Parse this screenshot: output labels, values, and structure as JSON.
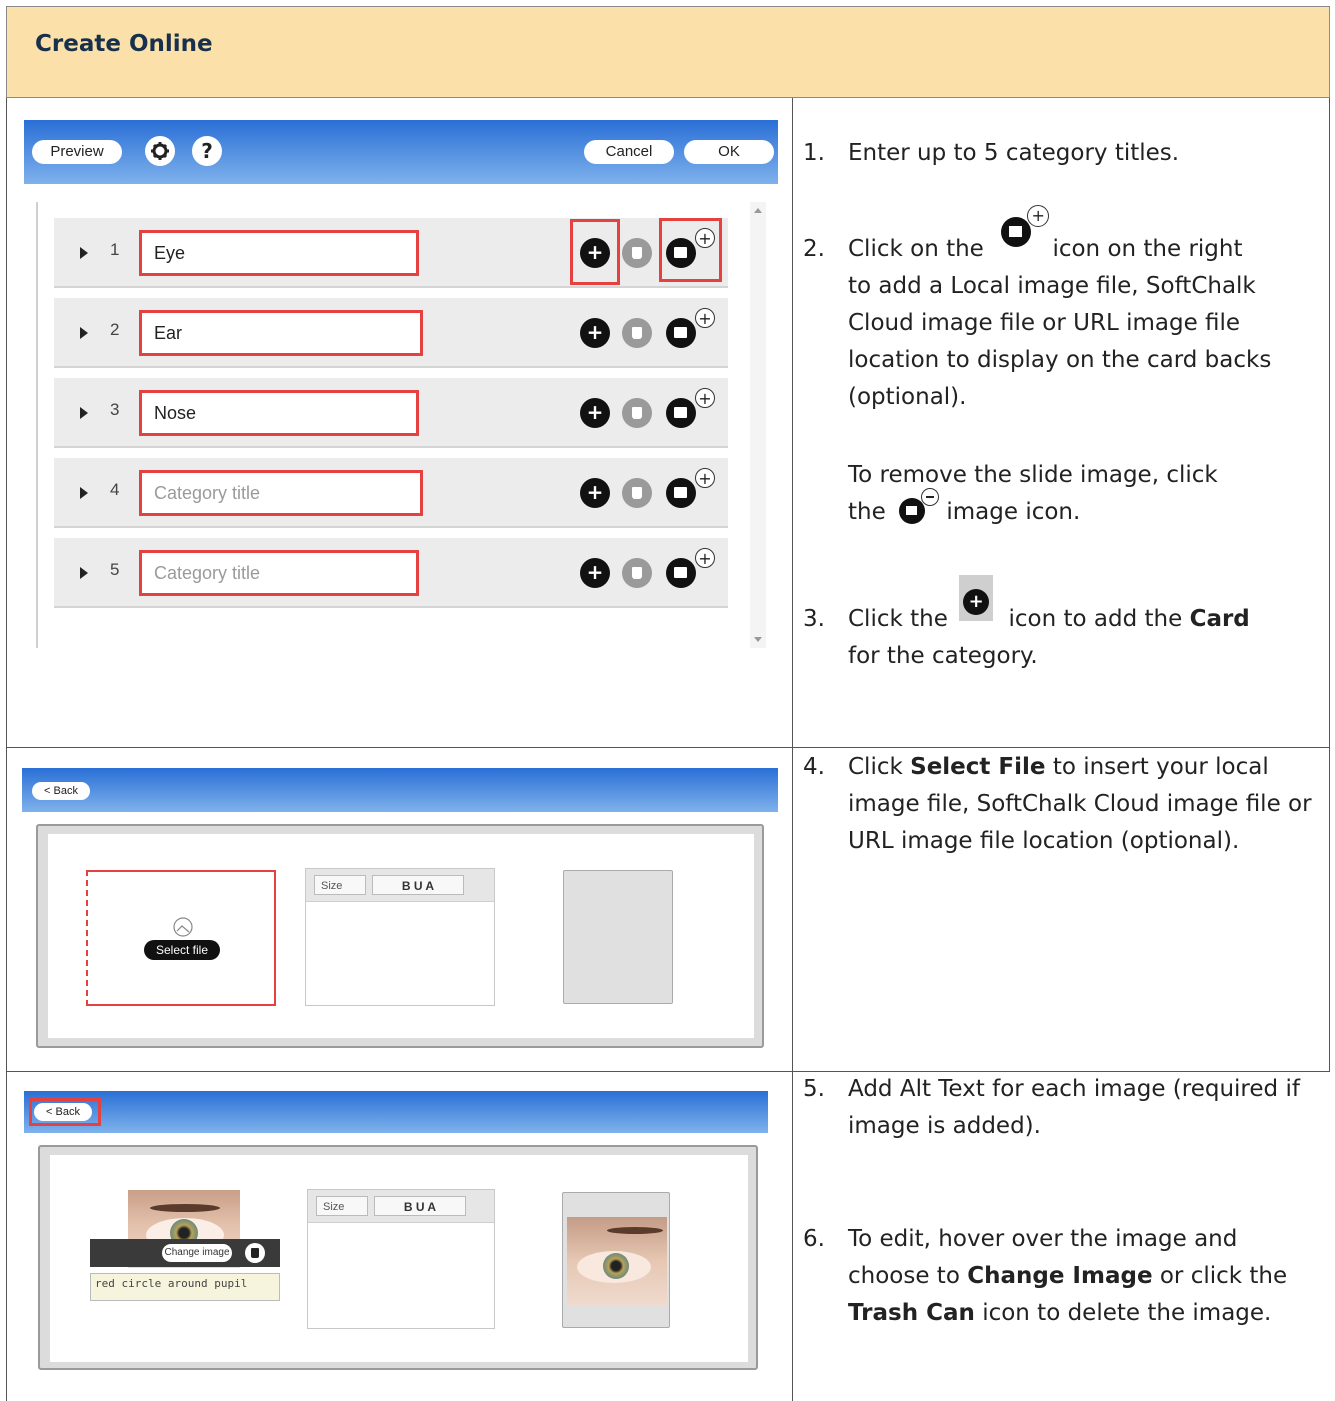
{
  "header": {
    "title": "Create Online"
  },
  "editor": {
    "preview_label": "Preview",
    "settings_icon": "gear-icon",
    "help_label": "?",
    "cancel_label": "Cancel",
    "ok_label": "OK",
    "categories": [
      {
        "num": "1",
        "value": "Eye",
        "placeholder": ""
      },
      {
        "num": "2",
        "value": "Ear",
        "placeholder": ""
      },
      {
        "num": "3",
        "value": "Nose",
        "placeholder": ""
      },
      {
        "num": "4",
        "value": "",
        "placeholder": "Category title"
      },
      {
        "num": "5",
        "value": "",
        "placeholder": "Category title"
      }
    ],
    "plus_glyph": "+"
  },
  "card_editor_a": {
    "back_label": "< Back",
    "select_file_label": "Select file",
    "size_label": "Size",
    "format_label": "B  U  A"
  },
  "card_editor_b": {
    "back_label": "< Back",
    "change_image_label": "Change image",
    "alt_text": "red circle around pupil",
    "size_label": "Size",
    "format_label": "B  U  A"
  },
  "steps": {
    "s1": {
      "n": "1.",
      "text": "Enter up to 5 category titles."
    },
    "s2": {
      "n": "2.",
      "a": "Click on the",
      "b": "icon on the right",
      "c": "to add a Local image file, SoftChalk Cloud image file or URL image file location to display on the card backs (optional)."
    },
    "s2b": {
      "a": "To remove the slide image, click",
      "b": "the",
      "c": "image icon."
    },
    "s3": {
      "n": "3.",
      "a": "Click the",
      "b": "icon to add the",
      "bold": "Card",
      "c": "for the category."
    },
    "s4": {
      "n": "4.",
      "a": "Click",
      "bold": "Select File",
      "c": "to insert your local image file, SoftChalk Cloud image file or URL image file location (optional)."
    },
    "s5": {
      "n": "5.",
      "text": "Add Alt Text for each image (required if image is added)."
    },
    "s6": {
      "n": "6.",
      "a": "To edit, hover over the image and choose to",
      "bold1": "Change Image",
      "b": "or click the",
      "bold2": "Trash Can",
      "c": "icon to delete the image."
    }
  }
}
